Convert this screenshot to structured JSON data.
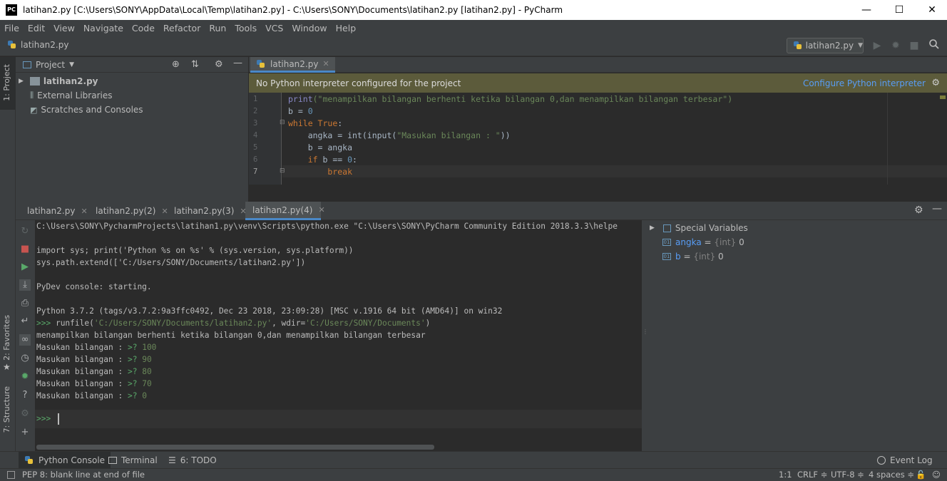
{
  "window": {
    "app_icon": "PC",
    "title": "latihan2.py [C:\\Users\\SONY\\AppData\\Local\\Temp\\latihan2.py] - C:\\Users\\SONY\\Documents\\latihan2.py [latihan2.py] - PyCharm",
    "minimize": "—",
    "maximize": "☐",
    "close": "✕"
  },
  "menu": [
    "File",
    "Edit",
    "View",
    "Navigate",
    "Code",
    "Refactor",
    "Run",
    "Tools",
    "VCS",
    "Window",
    "Help"
  ],
  "navbar": {
    "file": "latihan2.py",
    "run_config": "latihan2.py"
  },
  "left_strip": {
    "project": "1: Project",
    "favorites": "2: Favorites",
    "structure": "7: Structure"
  },
  "project": {
    "header": "Project",
    "items": [
      "latihan2.py",
      "External Libraries",
      "Scratches and Consoles"
    ]
  },
  "editor": {
    "tab": "latihan2.py",
    "warning": "No Python interpreter configured for the project",
    "configure_link": "Configure Python interpreter",
    "line_numbers": [
      "1",
      "2",
      "3",
      "4",
      "5",
      "6",
      "7"
    ],
    "lines": {
      "l1_fn": "print",
      "l1_str": "(\"menampilkan bilangan berhenti ketika bilangan 0,dan menampilkan bilangan terbesar\")",
      "l2_a": "b = ",
      "l2_num": "0",
      "l3_kw": "while ",
      "l3_true": "True",
      "l3_colon": ":",
      "l4_a": "    angka = int(input(",
      "l4_str": "\"Masukan bilangan : \"",
      "l4_b": "))",
      "l5": "    b = angka",
      "l6_kw": "    if ",
      "l6_a": "b == ",
      "l6_num": "0",
      "l6_colon": ":",
      "l7_kw": "        break"
    }
  },
  "run_tabs": [
    "latihan2.py",
    "latihan2.py(2)",
    "latihan2.py(3)",
    "latihan2.py(4)"
  ],
  "console": {
    "lines": [
      "C:\\Users\\SONY\\PycharmProjects\\latihan1.py\\venv\\Scripts\\python.exe \"C:\\Users\\SONY\\PyCharm Community Edition 2018.3.3\\helpe",
      "",
      "import sys; print('Python %s on %s' % (sys.version, sys.platform))",
      "sys.path.extend(['C:/Users/SONY/Documents/latihan2.py'])",
      "",
      "PyDev console: starting.",
      "",
      "Python 3.7.2 (tags/v3.7.2:9a3ffc0492, Dec 23 2018, 23:09:28) [MSC v.1916 64 bit (AMD64)] on win32"
    ],
    "runfile_prompt": ">>> ",
    "runfile_a": "runfile(",
    "runfile_path": "'C:/Users/SONY/Documents/latihan2.py'",
    "runfile_b": ", wdir=",
    "runfile_wdir": "'C:/Users/SONY/Documents'",
    "runfile_c": ")",
    "output_line": "menampilkan bilangan berhenti ketika bilangan 0,dan menampilkan bilangan terbesar",
    "input_label": "Masukan bilangan : ",
    "input_prompt": ">? ",
    "inputs": [
      "100",
      "90",
      "80",
      "70",
      "0"
    ],
    "final_prompt": ">>> "
  },
  "variables": {
    "special": "Special Variables",
    "items": [
      {
        "name": "angka",
        "eq": " = ",
        "type": "{int}",
        "value": " 0"
      },
      {
        "name": "b",
        "eq": " = ",
        "type": "{int}",
        "value": " 0"
      }
    ],
    "badge": "01"
  },
  "bottom_tools": {
    "python_console": "Python Console",
    "terminal": "Terminal",
    "todo": "6: TODO",
    "event_log": "Event Log"
  },
  "status": {
    "message": "PEP 8: blank line at end of file",
    "position": "1:1",
    "line_sep": "CRLF ≑",
    "encoding": "UTF-8 ≑",
    "indent": "4 spaces ≑"
  }
}
